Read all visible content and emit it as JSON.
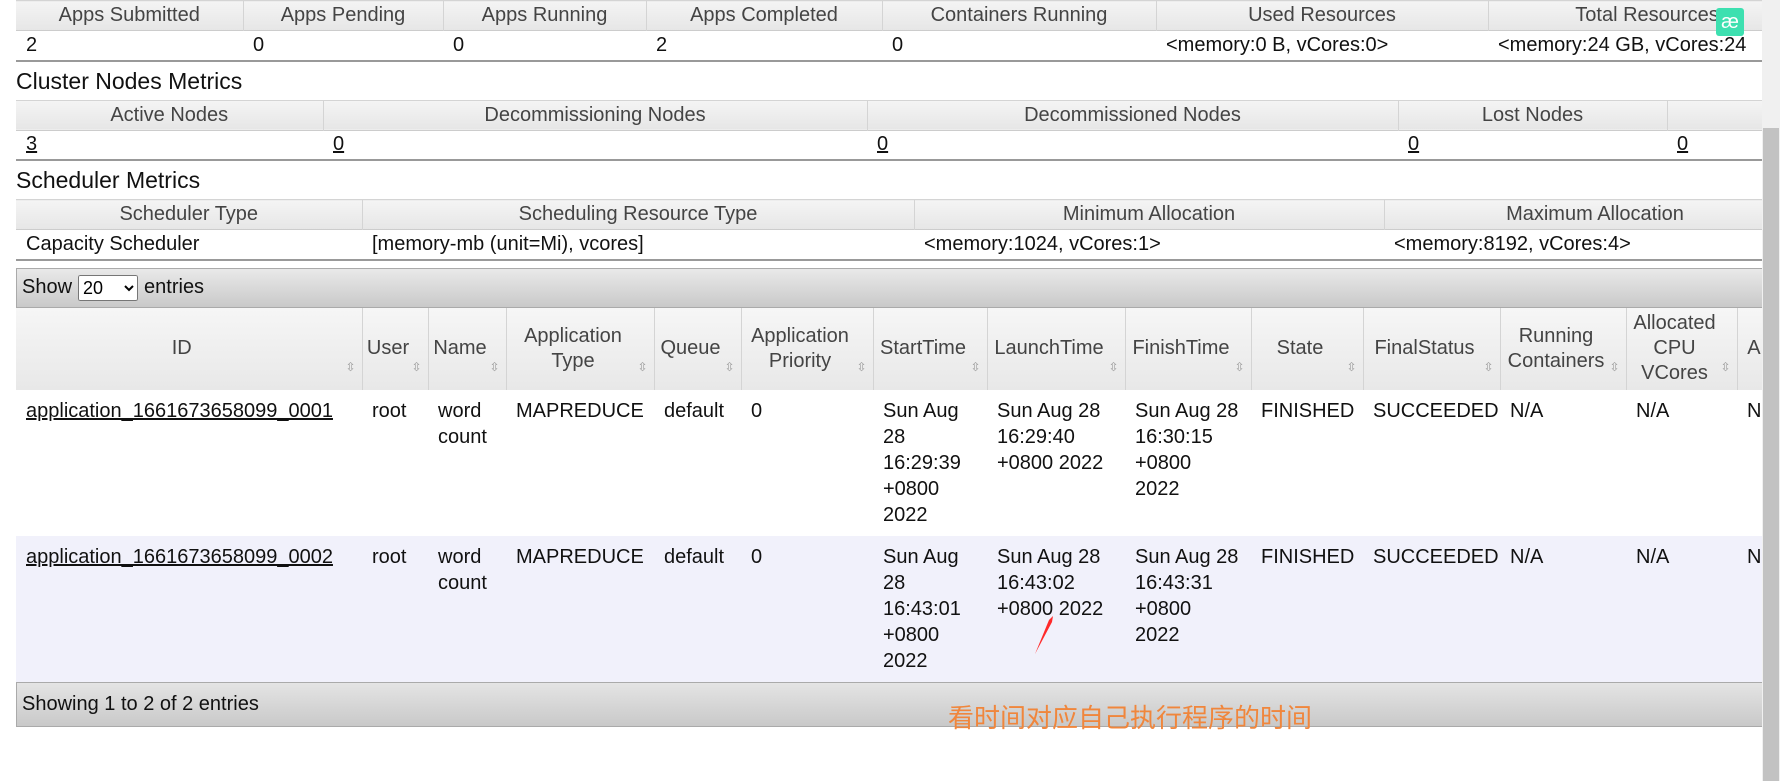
{
  "cluster_metrics": {
    "headers": [
      "Apps Submitted",
      "Apps Pending",
      "Apps Running",
      "Apps Completed",
      "Containers Running",
      "Used Resources",
      "Total Resources"
    ],
    "values": [
      "2",
      "0",
      "0",
      "2",
      "0",
      "<memory:0 B, vCores:0>",
      "<memory:24 GB, vCores:24"
    ]
  },
  "nodes": {
    "title": "Cluster Nodes Metrics",
    "headers": [
      "Active Nodes",
      "Decommissioning Nodes",
      "Decommissioned Nodes",
      "Lost Nodes",
      ""
    ],
    "values": [
      "3",
      "0",
      "0",
      "0",
      "0"
    ]
  },
  "scheduler": {
    "title": "Scheduler Metrics",
    "headers": [
      "Scheduler Type",
      "Scheduling Resource Type",
      "Minimum Allocation",
      "Maximum Allocation"
    ],
    "values": [
      "Capacity Scheduler",
      "[memory-mb (unit=Mi), vcores]",
      "<memory:1024, vCores:1>",
      "<memory:8192, vCores:4>"
    ]
  },
  "length": {
    "show": "Show",
    "value": "20",
    "entries": "entries"
  },
  "apps": {
    "headers": [
      "ID",
      "User",
      "Name",
      "Application Type",
      "Queue",
      "Application Priority",
      "StartTime",
      "LaunchTime",
      "FinishTime",
      "State",
      "FinalStatus",
      "Running Containers",
      "Allocated CPU VCores",
      "A M"
    ],
    "rows": [
      [
        "application_1661673658099_0001",
        "root",
        "word count",
        "MAPREDUCE",
        "default",
        "0",
        "Sun Aug 28 16:29:39 +0800 2022",
        "Sun Aug 28 16:29:40 +0800 2022",
        "Sun Aug 28 16:30:15 +0800 2022",
        "FINISHED",
        "SUCCEEDED",
        "N/A",
        "N/A",
        "N"
      ],
      [
        "application_1661673658099_0002",
        "root",
        "word count",
        "MAPREDUCE",
        "default",
        "0",
        "Sun Aug 28 16:43:01 +0800 2022",
        "Sun Aug 28 16:43:02 +0800 2022",
        "Sun Aug 28 16:43:31 +0800 2022",
        "FINISHED",
        "SUCCEEDED",
        "N/A",
        "N/A",
        "N"
      ]
    ]
  },
  "footer": "Showing 1 to 2 of 2 entries",
  "annotation": "看时间对应自己执行程序的时间",
  "colors": {
    "annotation": "#f0863c",
    "arrow": "#ff2a2a"
  }
}
